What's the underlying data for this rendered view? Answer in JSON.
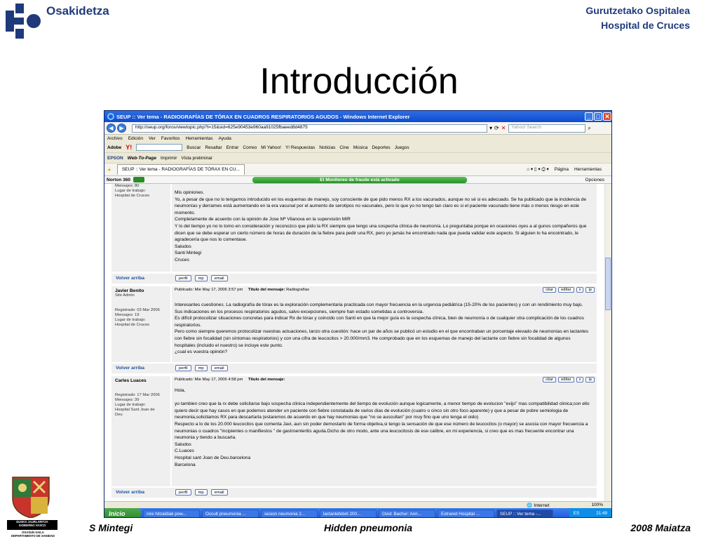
{
  "slide": {
    "org": "Osakidetza",
    "hospital_line1": "Gurutzetako Ospitalea",
    "hospital_line2": "Hospital de Cruces",
    "title": "Introducción",
    "footer_left": "S Mintegi",
    "footer_center": "Hidden pneumonia",
    "footer_right": "2008 Maiatza",
    "crest_line1": "EUSKO JAURLARITZA",
    "crest_line2": "GOBIERNO VASCO",
    "osasun_line1": "OSASUN SAILA",
    "osasun_line2": "DEPARTAMENTO DE SANIDAD",
    "colors": {
      "brand": "#1f3a7a",
      "title": "#000000"
    }
  },
  "browser": {
    "window_title": "SEUP :: Ver tema - RADIOGRAFÍAS DE TÓRAX EN CUADROS RESPIRATORIOS AGUDOS - Windows Internet Explorer",
    "address": "http://seup.org/foros/viewtopic.php?t=15&sid=625e90453e960aa91025fbaeed8d4875",
    "search_placeholder": "Yahoo! Search",
    "menu": [
      "Archivo",
      "Edición",
      "Ver",
      "Favoritos",
      "Herramientas",
      "Ayuda"
    ],
    "yahoo_toolbar": [
      "Adobe",
      "Y!",
      "Buscar",
      "Resaltar",
      "Entrar",
      "Correo",
      "Mi Yahoo!",
      "Y! Respuestas",
      "Noticias",
      "Cine",
      "Música",
      "Deportes",
      "Juegos"
    ],
    "epson_toolbar": [
      "EPSON",
      "Web-To-Page",
      "Imprimir",
      "Vista preliminar"
    ],
    "tab_label": "SEUP :: Ver tema - RADIOGRAFÍAS DE TÓRAX EN CU...",
    "tab_tools": [
      "Página",
      "Herramientas"
    ],
    "norton_label": "Norton 360",
    "norton_message": "El Monitoreo de fraude está activado",
    "norton_options": "Opciones",
    "status_zone": "Internet",
    "zoom": "100%"
  },
  "posts": [
    {
      "author": "",
      "meta": [
        "Mensajes: 80",
        "Lugar de trabajo:",
        "Hospital de Cruces"
      ],
      "text": "Mis opiniones.\nYo, a pesar de que no lo tengamos introducido en los esquemas de manejo, soy consciente de que pido menos RX a los vacunados, aunque no sé si es adecuado. Se ha publicado que la incidencia de neumonías y derrames está aumentando en la era vacunal por el aumento de serotipos no vacunales, pero lo que yo no tengo tan claro es si el paciente vacunado tiene más o menos riesgo en este momento.\nCompletamente de acuerdo con la opinión de Jose Mª Vilanova en la supervisión MIR\nY lo del tiempo yo no lo tomo en consideración y reconozco que pido la RX siempre que tengo una sospecha clínica de neumonía. Lo preguntaba porque en ocasiones oyes a al gunos compañeros que dicen que se debe esperar un cierto número de horas de duración de la fiebre para pedir una RX, pero yo jamás he encontrado nada que pueda validar este aspecto. Si alguien lo ha encointrado, le agradecería que nos lo comentase.\nSaludos\nSanti Mintegi\nCruces"
    },
    {
      "author": "Javier Benito",
      "meta": [
        "Site Admin",
        "",
        "",
        "Registrado: 03 Mar 2006",
        "Mensajes: 19",
        "Lugar de trabajo:",
        "Hospital de Cruces"
      ],
      "posted": "Publicado: Mie May 17, 2006 3:57 pm",
      "subject_label": "Título del mensaje:",
      "subject": "Radiografías",
      "text": "Interesantes cuestiones. La radiografía de tórax es la exploración complementaria practicada con mayor frecuencia en la urgencia pediátrica (15-20% de los pacientes) y con un rendimiento muy bajo. Sus indicaciones en los procesos respiratorios agudos, salvo excepciones, siempre han estado sometidas a controversia.\nEs difícil protocolizar situaciones concretas para indicar Rx de tórax y coincido con Santi en que la mejor guía es la sospecha clínica, bien de neumonía o de cualquier otra complicación de los cuadros respiratorios.\nPero como siempre queremos protocolizar nuestras actuaciones, lanzo otra cuestión: hace un par de años se publicó un estudio en el que encontraban un porcentaje elevado de neumonías en lactantes con fiebre sin focalidad (sin síntomas respiratorios) y con una cifra de leucocitos > 20.000/mm3. He comprobado que en los esquemas de manejo del lactante con fiebre sin focalidad de algunos hospitales (incluido el nuestro) se incluye este punto.\n¿cual es vuestra opinión?"
    },
    {
      "author": "Carles Luaces",
      "meta": [
        "",
        "",
        "Registrado: 17 Mar 2006",
        "Mensajes: 39",
        "Lugar de trabajo:",
        "Hospital Sant Joan de",
        "Deu"
      ],
      "posted": "Publicado: Mie May 17, 2006 4:58 pm",
      "subject_label": "Título del mensaje:",
      "subject": "",
      "text": "Hola,\n\nyo tambien creo que la rx debe solicitarse bajo sospecha clinica independientemente del tiempo de evolución aunque logicamente, a menor tiempo de evolucion \"exijo\" mas compatibilidad clinica;con ello quiero decir que hay casos en que podemos atender un paciente con fiebre constatada de varios dias de evolución (cuatro o cinco sin otro foco aparente) y que a pesar de pobre semiologia de neumonia,solicitamos RX para descartarla (estaremos de acuerdo en que hay neumonias que \"no se auscultan\" por muy fino que uno tenga el oido)\nRespecto a lo de los 20.000 leucocitos que comenta Javi, aun sin poder demostarlo de forma objetiva,si tengo la sensación de que ese número de leucocitos (o mayor) se asocia con mayor frecuencia a neumonias o cuadros \"incipientes o manifiestos \" de gastroenteritis aguda.Dicho de otro modo, ante una leucocitosis de ese calibre, en mi experiencia, si creo que es mas frecuente encontrar una neumonia y tiendo a buscarla.\nSaludos\nC.Luaces\nHospital sant Joan de Deu.barcelona\nBarcelona"
    }
  ],
  "post_actions": [
    "citar",
    "editar",
    "x",
    "ip"
  ],
  "footer_buttons": [
    "perfil",
    "mp",
    "email"
  ],
  "back_to_top": "Volver arriba",
  "taskbar": {
    "start": "Inicio",
    "tasks": [
      "nire hitzaldiak pow...",
      "Occult pneumonia ...",
      "sesion neumonia 2...",
      "lactantefebril 200...",
      "Ovid: Bachur: Ann...",
      "Extranet Hospital ...",
      "SEUP :: Ver tema -..."
    ],
    "lang": "ES",
    "clock": "21:49"
  }
}
